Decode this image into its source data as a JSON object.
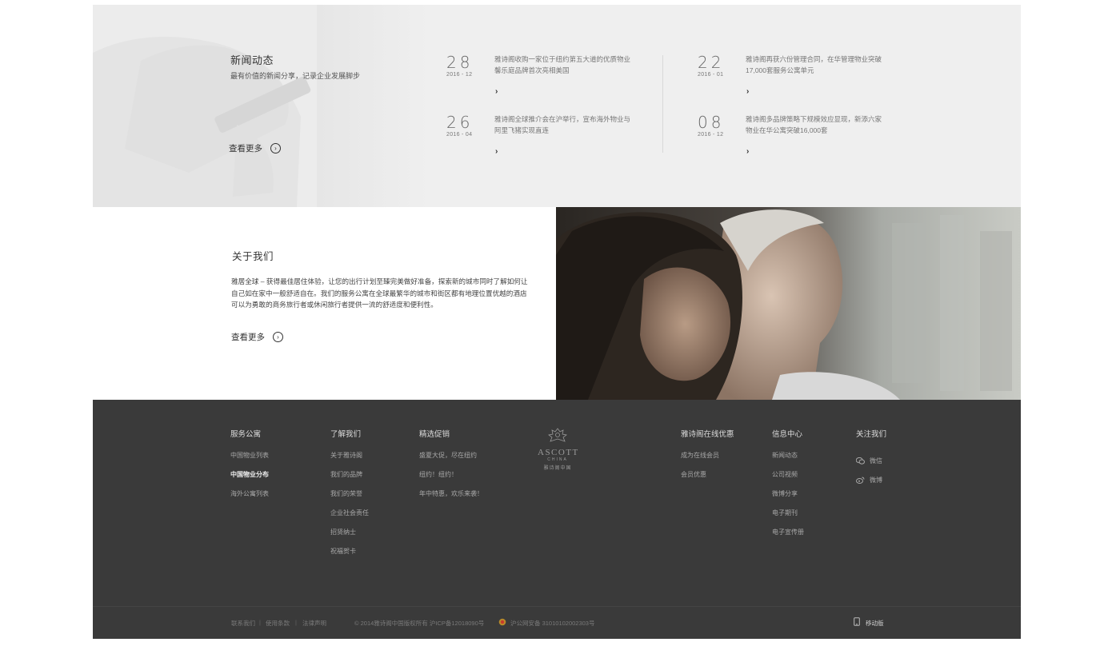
{
  "news": {
    "title": "新闻动态",
    "subtitle": "最有价值的新闻分享，记录企业发展脚步",
    "more_label": "查看更多",
    "items": [
      {
        "day": "28",
        "ym": "2016 - 12",
        "text": "雅诗阁收购一家位于纽约第五大道的优质物业 馨乐庭品牌首次亮相美国",
        "arrow": "›"
      },
      {
        "day": "26",
        "ym": "2016 - 04",
        "text": "雅诗阁全球推介会在沪举行，宣布海外物业与 阿里飞猪实现直连",
        "arrow": "›"
      },
      {
        "day": "22",
        "ym": "2016 - 01",
        "text": "雅诗阁再获六份管理合同，在华管理物业突破 17,000套服务公寓单元",
        "arrow": "›"
      },
      {
        "day": "08",
        "ym": "2016 - 12",
        "text": "雅诗阁多品牌策略下规模效应显现，新添六家 物业在华公寓突破16,000套",
        "arrow": "›"
      }
    ]
  },
  "about": {
    "title": "关于我们",
    "description": "雅居全球 – 获得最佳居住体验，让您的出行计划至臻完美做好准备，探索新的城市同时了解如何让自己如在家中一般舒适自在。我们的服务公寓在全球最繁华的城市和街区都有地理位置优越的酒店 可以为勇敢的商务旅行者或休闲旅行者提供一流的舒适度和便利性。",
    "more_label": "查看更多"
  },
  "footer": {
    "columns": [
      {
        "title": "服务公寓",
        "links": [
          "中国物业列表",
          "中国物业分布",
          "海外公寓列表"
        ],
        "active_index": 1
      },
      {
        "title": "了解我们",
        "links": [
          "关于雅诗阁",
          "我们的品牌",
          "我们的荣誉",
          "企业社会责任",
          "招贤纳士",
          "祝福贺卡"
        ]
      },
      {
        "title": "精选促销",
        "links": [
          "盛夏大促，尽在纽约",
          "纽约！纽约！",
          "年中特惠，欢乐来袭！"
        ]
      },
      {
        "title": "雅诗阁在线优惠",
        "links": [
          "成为在线会员",
          "会员优惠"
        ]
      },
      {
        "title": "信息中心",
        "links": [
          "新闻动态",
          "公司视频",
          "微博分享",
          "电子期刊",
          "电子宣传册"
        ]
      },
      {
        "title": "关注我们",
        "links": [
          "微信",
          "微博"
        ]
      }
    ],
    "logo": {
      "word": "ASCOTT",
      "sub": "CHINA",
      "cn": "雅诗阁中国"
    },
    "bottom": {
      "links": [
        "联系我们",
        "使用条款",
        "法律声明"
      ],
      "separator": "|",
      "copyright": "© 2014雅诗阁中国版权所有 沪ICP备12018090号",
      "police": "沪公网安备 31010102002303号",
      "mobile": "移动版"
    }
  },
  "colors": {
    "news_bg": "#efefef",
    "footer_bg": "#3a3a3a",
    "text_dark": "#333333"
  }
}
